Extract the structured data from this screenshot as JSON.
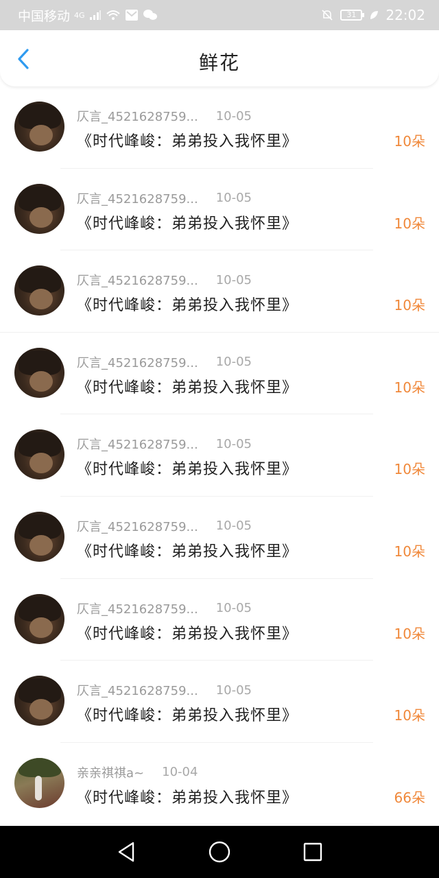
{
  "status_bar": {
    "carrier": "中国移动",
    "network": "4G",
    "battery": "31",
    "time": "22:02"
  },
  "header": {
    "title": "鲜花"
  },
  "colors": {
    "accent": "#f0883a",
    "back_arrow": "#2f9bf0",
    "status_bar_bg": "#d6d6d6"
  },
  "items": [
    {
      "user": "仄言_4521628759...",
      "date": "10-05",
      "title": "《时代峰峻：弟弟投入我怀里》",
      "amount": "10朵"
    },
    {
      "user": "仄言_4521628759...",
      "date": "10-05",
      "title": "《时代峰峻：弟弟投入我怀里》",
      "amount": "10朵"
    },
    {
      "user": "仄言_4521628759...",
      "date": "10-05",
      "title": "《时代峰峻：弟弟投入我怀里》",
      "amount": "10朵"
    },
    {
      "user": "仄言_4521628759...",
      "date": "10-05",
      "title": "《时代峰峻：弟弟投入我怀里》",
      "amount": "10朵"
    },
    {
      "user": "仄言_4521628759...",
      "date": "10-05",
      "title": "《时代峰峻：弟弟投入我怀里》",
      "amount": "10朵"
    },
    {
      "user": "仄言_4521628759...",
      "date": "10-05",
      "title": "《时代峰峻：弟弟投入我怀里》",
      "amount": "10朵"
    },
    {
      "user": "仄言_4521628759...",
      "date": "10-05",
      "title": "《时代峰峻：弟弟投入我怀里》",
      "amount": "10朵"
    },
    {
      "user": "仄言_4521628759...",
      "date": "10-05",
      "title": "《时代峰峻：弟弟投入我怀里》",
      "amount": "10朵"
    },
    {
      "user": "亲亲祺祺a~",
      "date": "10-04",
      "title": "《时代峰峻：弟弟投入我怀里》",
      "amount": "66朵"
    }
  ],
  "nav": {
    "icons": [
      "back-triangle-icon",
      "home-circle-icon",
      "recents-square-icon"
    ]
  }
}
